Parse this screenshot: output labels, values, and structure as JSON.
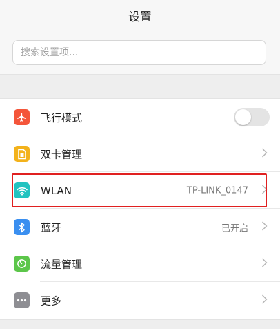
{
  "header": {
    "title": "设置"
  },
  "search": {
    "placeholder": "搜索设置项..."
  },
  "settings": [
    {
      "key": "airplane",
      "label": "飞行模式",
      "value": "",
      "icon": "airplane-icon",
      "icon_color": "#f4553a",
      "control": "toggle",
      "toggle_on": false
    },
    {
      "key": "dual-sim",
      "label": "双卡管理",
      "value": "",
      "icon": "sim-card-icon",
      "icon_color": "#f3b21b",
      "control": "chevron"
    },
    {
      "key": "wlan",
      "label": "WLAN",
      "value": "TP-LINK_0147",
      "icon": "wifi-icon",
      "icon_color": "#22c3c0",
      "control": "chevron"
    },
    {
      "key": "bluetooth",
      "label": "蓝牙",
      "value": "已开启",
      "icon": "bluetooth-icon",
      "icon_color": "#3a8ff0",
      "control": "chevron"
    },
    {
      "key": "data-usage",
      "label": "流量管理",
      "value": "",
      "icon": "data-usage-icon",
      "icon_color": "#5cc64a",
      "control": "chevron"
    },
    {
      "key": "more",
      "label": "更多",
      "value": "",
      "icon": "more-icon",
      "icon_color": "#8e8e93",
      "control": "chevron"
    }
  ],
  "colors": {
    "highlight": "#e02020",
    "background": "#f2f2f2"
  }
}
